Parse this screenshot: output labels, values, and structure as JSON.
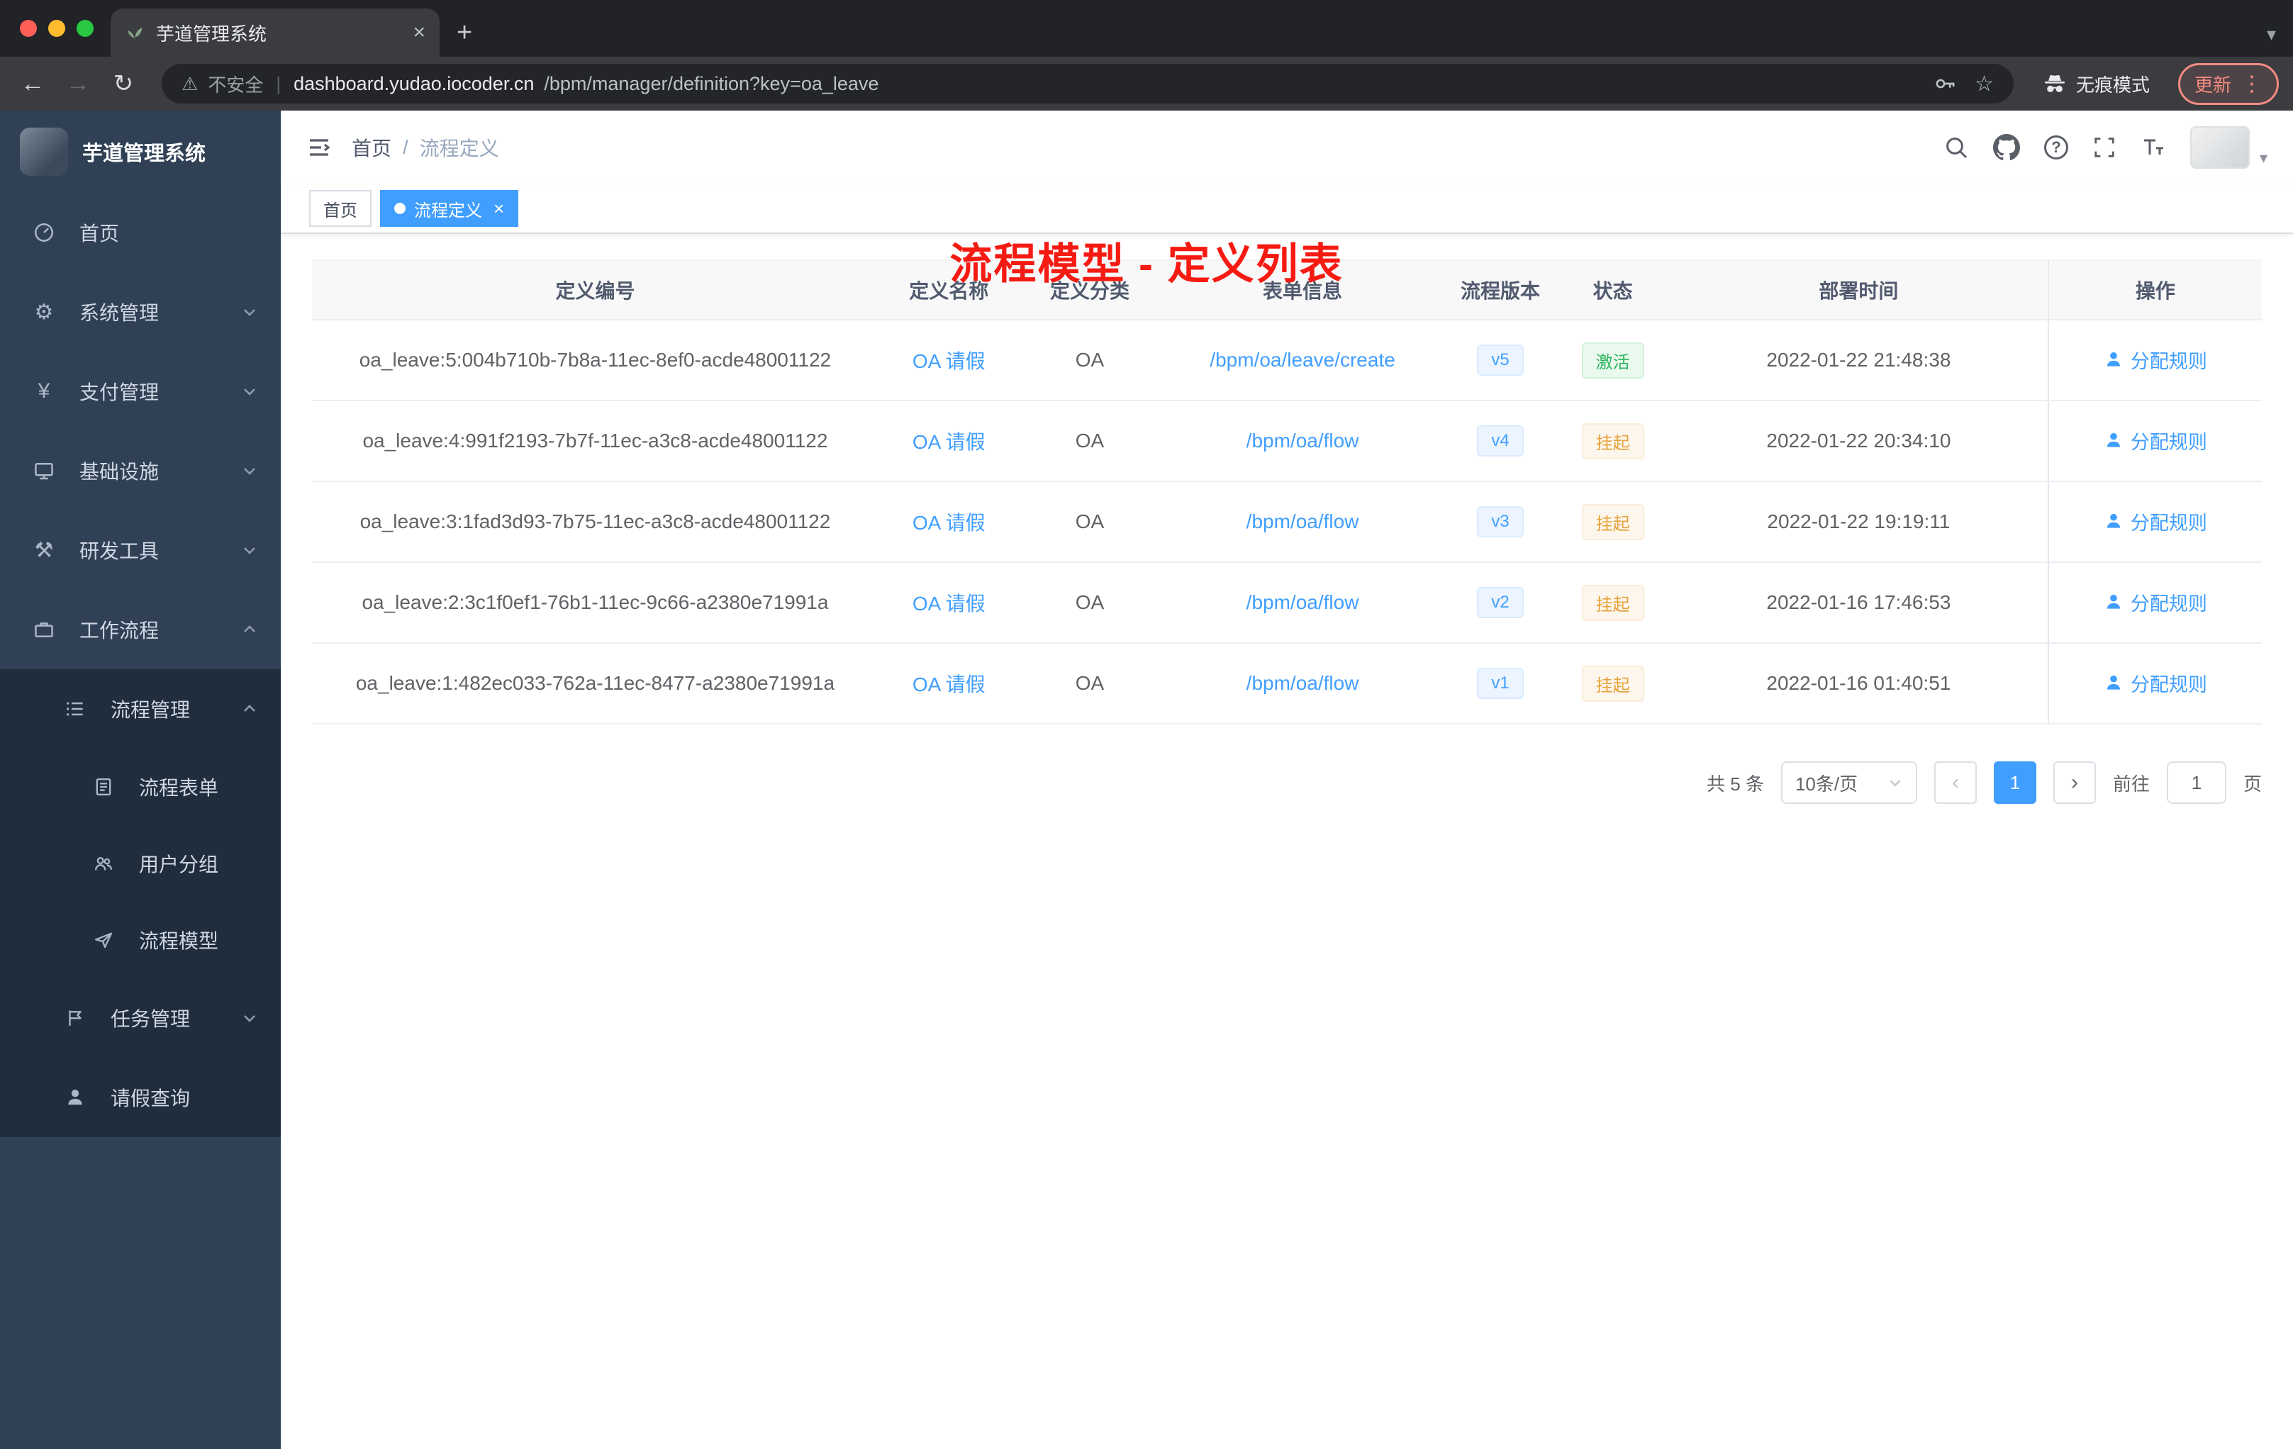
{
  "colors": {
    "accent": "#409eff",
    "success_green": "#2bb55f",
    "warning_orange": "#e6a23c",
    "annotation_red": "#f51b12",
    "sidebar_bg": "#304156",
    "submenu_bg": "#1f2d3d"
  },
  "browser": {
    "tab_title": "芋道管理系统",
    "security_label": "不安全",
    "url_host": "dashboard.yudao.iocoder.cn",
    "url_path": "/bpm/manager/definition?key=oa_leave",
    "incognito_label": "无痕模式",
    "update_label": "更新"
  },
  "sidebar": {
    "app_title": "芋道管理系统",
    "items": [
      {
        "label": "首页"
      },
      {
        "label": "系统管理"
      },
      {
        "label": "支付管理"
      },
      {
        "label": "基础设施"
      },
      {
        "label": "研发工具"
      },
      {
        "label": "工作流程"
      },
      {
        "label": "流程管理"
      },
      {
        "label": "流程表单"
      },
      {
        "label": "用户分组"
      },
      {
        "label": "流程模型"
      },
      {
        "label": "任务管理"
      },
      {
        "label": "请假查询"
      }
    ]
  },
  "header": {
    "breadcrumb_home": "首页",
    "breadcrumb_separator": "/",
    "breadcrumb_current": "流程定义",
    "annotation": "流程模型 - 定义列表"
  },
  "tags": [
    {
      "label": "首页"
    },
    {
      "label": "流程定义"
    }
  ],
  "table": {
    "columns": [
      "定义编号",
      "定义名称",
      "定义分类",
      "表单信息",
      "流程版本",
      "状态",
      "部署时间",
      "操作"
    ],
    "rows": [
      {
        "id": "oa_leave:5:004b710b-7b8a-11ec-8ef0-acde48001122",
        "name": "OA 请假",
        "category": "OA",
        "form": "/bpm/oa/leave/create",
        "version": "v5",
        "status": "激活",
        "time": "2022-01-22 21:48:38",
        "action": "分配规则"
      },
      {
        "id": "oa_leave:4:991f2193-7b7f-11ec-a3c8-acde48001122",
        "name": "OA 请假",
        "category": "OA",
        "form": "/bpm/oa/flow",
        "version": "v4",
        "status": "挂起",
        "time": "2022-01-22 20:34:10",
        "action": "分配规则"
      },
      {
        "id": "oa_leave:3:1fad3d93-7b75-11ec-a3c8-acde48001122",
        "name": "OA 请假",
        "category": "OA",
        "form": "/bpm/oa/flow",
        "version": "v3",
        "status": "挂起",
        "time": "2022-01-22 19:19:11",
        "action": "分配规则"
      },
      {
        "id": "oa_leave:2:3c1f0ef1-76b1-11ec-9c66-a2380e71991a",
        "name": "OA 请假",
        "category": "OA",
        "form": "/bpm/oa/flow",
        "version": "v2",
        "status": "挂起",
        "time": "2022-01-16 17:46:53",
        "action": "分配规则"
      },
      {
        "id": "oa_leave:1:482ec033-762a-11ec-8477-a2380e71991a",
        "name": "OA 请假",
        "category": "OA",
        "form": "/bpm/oa/flow",
        "version": "v1",
        "status": "挂起",
        "time": "2022-01-16 01:40:51",
        "action": "分配规则"
      }
    ]
  },
  "pagination": {
    "total": "共 5 条",
    "size": "10条/页",
    "page": "1",
    "goto_label": "前往",
    "goto_value": "1",
    "unit": "页"
  }
}
